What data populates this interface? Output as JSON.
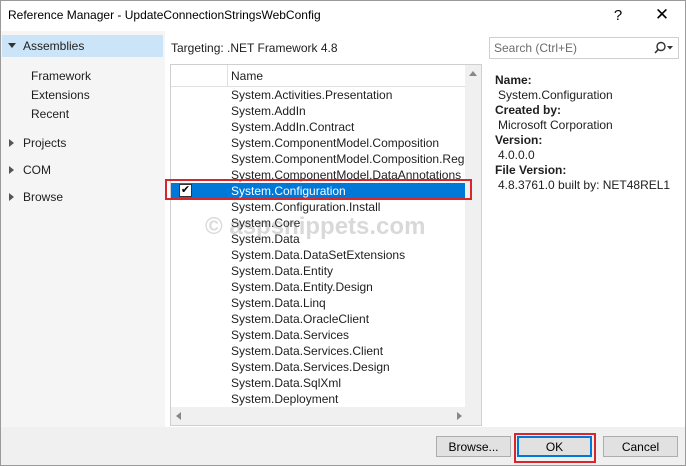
{
  "window": {
    "title": "Reference Manager - UpdateConnectionStringsWebConfig",
    "help_label": "?",
    "close_label": "✕"
  },
  "sidebar": {
    "assemblies": "Assemblies",
    "sub_items": [
      "Framework",
      "Extensions",
      "Recent"
    ],
    "projects": "Projects",
    "com": "COM",
    "browse": "Browse"
  },
  "targeting": "Targeting: .NET Framework 4.8",
  "list": {
    "header_name": "Name",
    "rows": [
      "System.Activities.Presentation",
      "System.AddIn",
      "System.AddIn.Contract",
      "System.ComponentModel.Composition",
      "System.ComponentModel.Composition.Registration",
      "System.ComponentModel.DataAnnotations",
      "System.Configuration",
      "System.Configuration.Install",
      "System.Core",
      "System.Data",
      "System.Data.DataSetExtensions",
      "System.Data.Entity",
      "System.Data.Entity.Design",
      "System.Data.Linq",
      "System.Data.OracleClient",
      "System.Data.Services",
      "System.Data.Services.Client",
      "System.Data.Services.Design",
      "System.Data.SqlXml",
      "System.Deployment"
    ],
    "checkmark": "✔"
  },
  "search": {
    "placeholder": "Search (Ctrl+E)"
  },
  "details": {
    "name_label": "Name:",
    "name_value": "System.Configuration",
    "created_label": "Created by:",
    "created_value": "Microsoft Corporation",
    "version_label": "Version:",
    "version_value": "4.0.0.0",
    "file_version_label": "File Version:",
    "file_version_value": "4.8.3761.0 built by: NET48REL1"
  },
  "buttons": {
    "browse": "Browse...",
    "ok": "OK",
    "cancel": "Cancel"
  },
  "watermark": "© aspsnippets.com",
  "colors": {
    "selection": "#0078d7",
    "nav_selected": "#cce4f7",
    "annotation": "#d9262b"
  }
}
